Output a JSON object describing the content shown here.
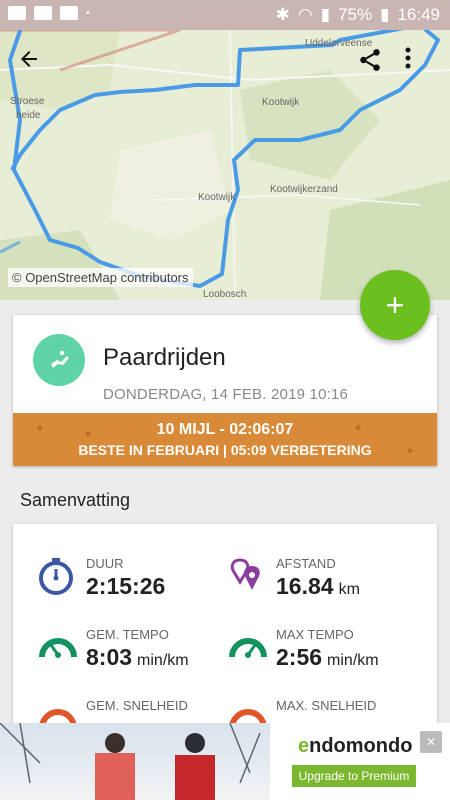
{
  "status_bar": {
    "battery": "75%",
    "time": "16:49"
  },
  "map": {
    "labels": [
      "Stroese",
      "heide",
      "Kootwijk",
      "Kootwijk",
      "Kootwijkerzand",
      "Loobosch",
      "Uddelerveense"
    ],
    "attribution": "© OpenStreetMap contributors"
  },
  "workout": {
    "sport": "Paardrijden",
    "date": "DONDERDAG, 14 FEB. 2019 10:16",
    "banner_line1": "10 MIJL  -  02:06:07",
    "banner_line2": "BESTE IN FEBRUARI  |  05:09 VERBETERING"
  },
  "summary": {
    "title": "Samenvatting",
    "stats": [
      {
        "label": "DUUR",
        "value": "2:15:26",
        "unit": ""
      },
      {
        "label": "AFSTAND",
        "value": "16.84",
        "unit": "km"
      },
      {
        "label": "GEM. TEMPO",
        "value": "8:03",
        "unit": "min/km"
      },
      {
        "label": "MAX TEMPO",
        "value": "2:56",
        "unit": "min/km"
      },
      {
        "label": "GEM. SNELHEID",
        "value": "",
        "unit": ""
      },
      {
        "label": "MAX. SNELHEID",
        "value": "",
        "unit": ""
      }
    ]
  },
  "ad": {
    "brand_prefix": "e",
    "brand": "ndomondo",
    "cta": "Upgrade to Premium"
  },
  "colors": {
    "route": "#4a9be6",
    "fab": "#6bbf1f",
    "banner": "#d88a38",
    "avatar": "#5fd3a5",
    "duration_icon": "#3d57a8",
    "distance_icon": "#8b3d9d",
    "tempo_icon": "#149160",
    "speed_icon": "#e0552a"
  },
  "icons": [
    "back-arrow-icon",
    "share-icon",
    "more-vert-icon",
    "plus-icon",
    "horse-riding-icon",
    "stopwatch-icon",
    "location-pins-icon",
    "gauge-icon",
    "close-ad-icon"
  ]
}
